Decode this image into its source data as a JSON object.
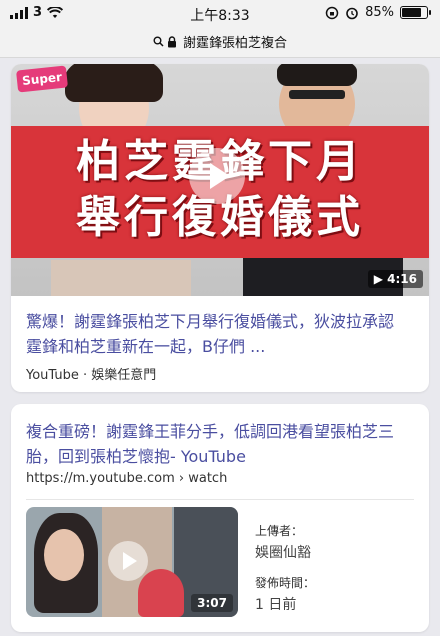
{
  "status_bar": {
    "carrier": "3",
    "time": "上午8:33",
    "battery": "85%",
    "battery_level": 0.85
  },
  "url_bar": {
    "query": "謝霆鋒張柏芝複合"
  },
  "result1": {
    "banner_line1": "柏芝霆鋒下月",
    "banner_line2": "舉行復婚儀式",
    "logo": "Super",
    "duration": "4:16",
    "title": "驚爆！謝霆鋒張柏芝下月舉行復婚儀式，狄波拉承認霆鋒和柏芝重新在一起，B仔們 ...",
    "source": "YouTube · 娛樂任意門"
  },
  "result2": {
    "title": "複合重磅！謝霆鋒王菲分手，低調回港看望張柏芝三胎，回到張柏芝懷抱- YouTube",
    "url": "https://m.youtube.com › watch",
    "duration": "3:07",
    "uploader_label": "上傳者：",
    "uploader": "娛圈仙豁",
    "time_label": "發佈時間：",
    "time": "1 日前"
  },
  "colors": {
    "banner": "#d8343a",
    "link": "#4a4ea0"
  }
}
